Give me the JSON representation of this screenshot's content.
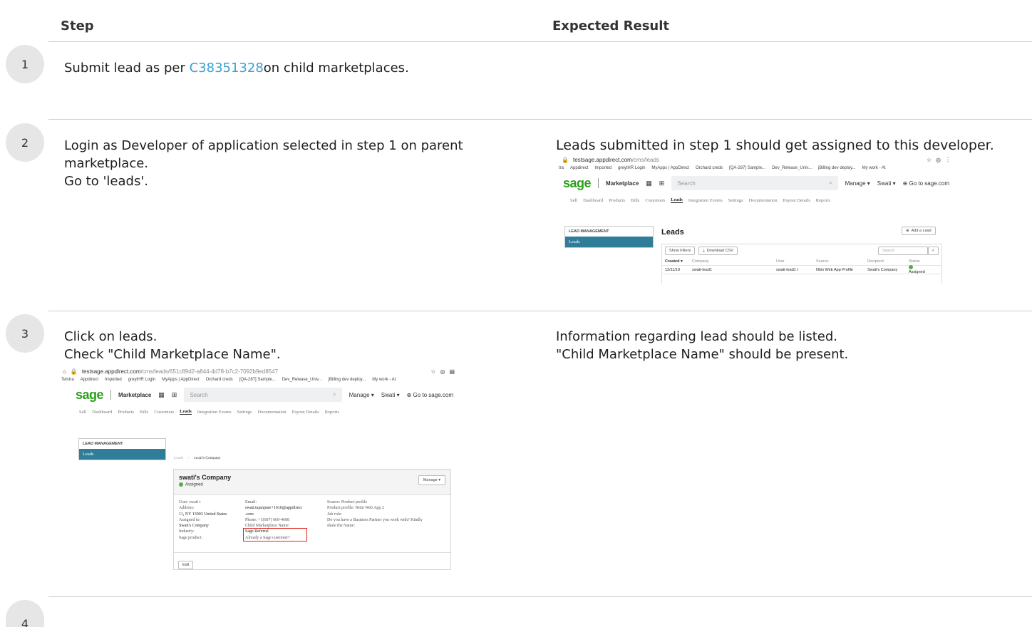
{
  "headers": {
    "step": "Step",
    "expected": "Expected Result"
  },
  "steps": [
    {
      "number": "1",
      "text_before_link": "Submit lead as per ",
      "link": "C38351328",
      "text_after_link": "on child marketplaces."
    },
    {
      "number": "2",
      "lines": [
        "Login as Developer of application selected in step 1 on parent",
        "marketplace.",
        "Go to 'leads'."
      ],
      "expected": "Leads submitted in step 1 should get assigned to this developer."
    },
    {
      "number": "3",
      "lines": [
        "Click on leads.",
        "Check \"Child Marketplace Name\"."
      ],
      "expected_lines": [
        "Information regarding lead should be listed.",
        "\"Child Marketplace Name\" should be present."
      ]
    },
    {
      "number": "4"
    }
  ],
  "shot_leads": {
    "url_host": "testsage.appdirect.com",
    "url_path": "/cms/leads",
    "bookmarks": [
      "tra",
      "Appdirect",
      "Imported",
      "greytHR Login",
      "MyApps | AppDirect",
      "Orchard creds",
      "[QA-287] Sample...",
      "Dev_Release_Univ...",
      "jBilling dev deploy...",
      "My work - At"
    ],
    "logo": "sage",
    "marketplace": "Marketplace",
    "search_placeholder": "Search",
    "manage": "Manage ▾",
    "user": "Swati ▾",
    "go_to": "⊕ Go to sage.com",
    "subnav": [
      "Sell",
      "Dashboard",
      "Products",
      "Bills",
      "Customers",
      "Leads",
      "Integration Events",
      "Settings",
      "Documentation",
      "Payout Details",
      "Reports"
    ],
    "side_head": "LEAD MANAGEMENT",
    "side_item": "Leads",
    "page_title": "Leads",
    "add_lead": "Add a Lead",
    "show_filters": "Show Filters",
    "download_csv": "Download CSV",
    "table_search": "Search",
    "columns": [
      "Created ▾",
      "Company",
      "User",
      "Source",
      "Recipient",
      "Status"
    ],
    "row": [
      "13/11/19",
      "swati-lead1",
      "swati-lead1 t",
      "Nitin Web App Profile",
      "Swati's Company",
      "Assigned"
    ]
  },
  "shot_detail": {
    "url_host": "testsage.appdirect.com",
    "url_path": "/cms/leads/651c89d2-a844-4d78-b7c2-7092b9ed8547",
    "bookmarks": [
      "Telstra",
      "Appdirect",
      "Imported",
      "greytHR Login",
      "MyApps | AppDirect",
      "Orchard creds",
      "[QA-287] Sample...",
      "Dev_Release_Univ...",
      "jBilling dev deploy...",
      "My work - At"
    ],
    "logo": "sage",
    "marketplace": "Marketplace",
    "search_placeholder": "Search",
    "manage": "Manage ▾",
    "user": "Swati ▾",
    "go_to": "⊕ Go to sage.com",
    "subnav": [
      "Sell",
      "Dashboard",
      "Products",
      "Bills",
      "Customers",
      "Leads",
      "Integration Events",
      "Settings",
      "Documentation",
      "Payout Details",
      "Reports"
    ],
    "side_head": "LEAD MANAGEMENT",
    "side_item": "Leads",
    "breadcrumb_root": "Leads",
    "breadcrumb_sep": ">",
    "breadcrumb_current": "swati's Company",
    "company": "swati's Company",
    "status": "Assigned",
    "manage_btn": "Manage ▾",
    "col1": [
      "User:  swati t",
      "Address:",
      "  11, NY 13903 United States",
      "Assigned to:",
      "  Swati's Company",
      "Industry:",
      "Sage product:"
    ],
    "col2": [
      "Email:",
      "  swati.tajanpure+1610@appdirect",
      "  .com",
      "Phone:  +1(607) 669-4608",
      "Child Marketplace Name:",
      "  Sage Referral",
      "Already a Sage customer?"
    ],
    "col3": [
      "Source:  Product profile",
      "Product profile:  Nitin Web App 2",
      "Job role:",
      "Do you have a Business Partner you work with? Kindly",
      "share the Name:"
    ],
    "edit": "Edit"
  }
}
